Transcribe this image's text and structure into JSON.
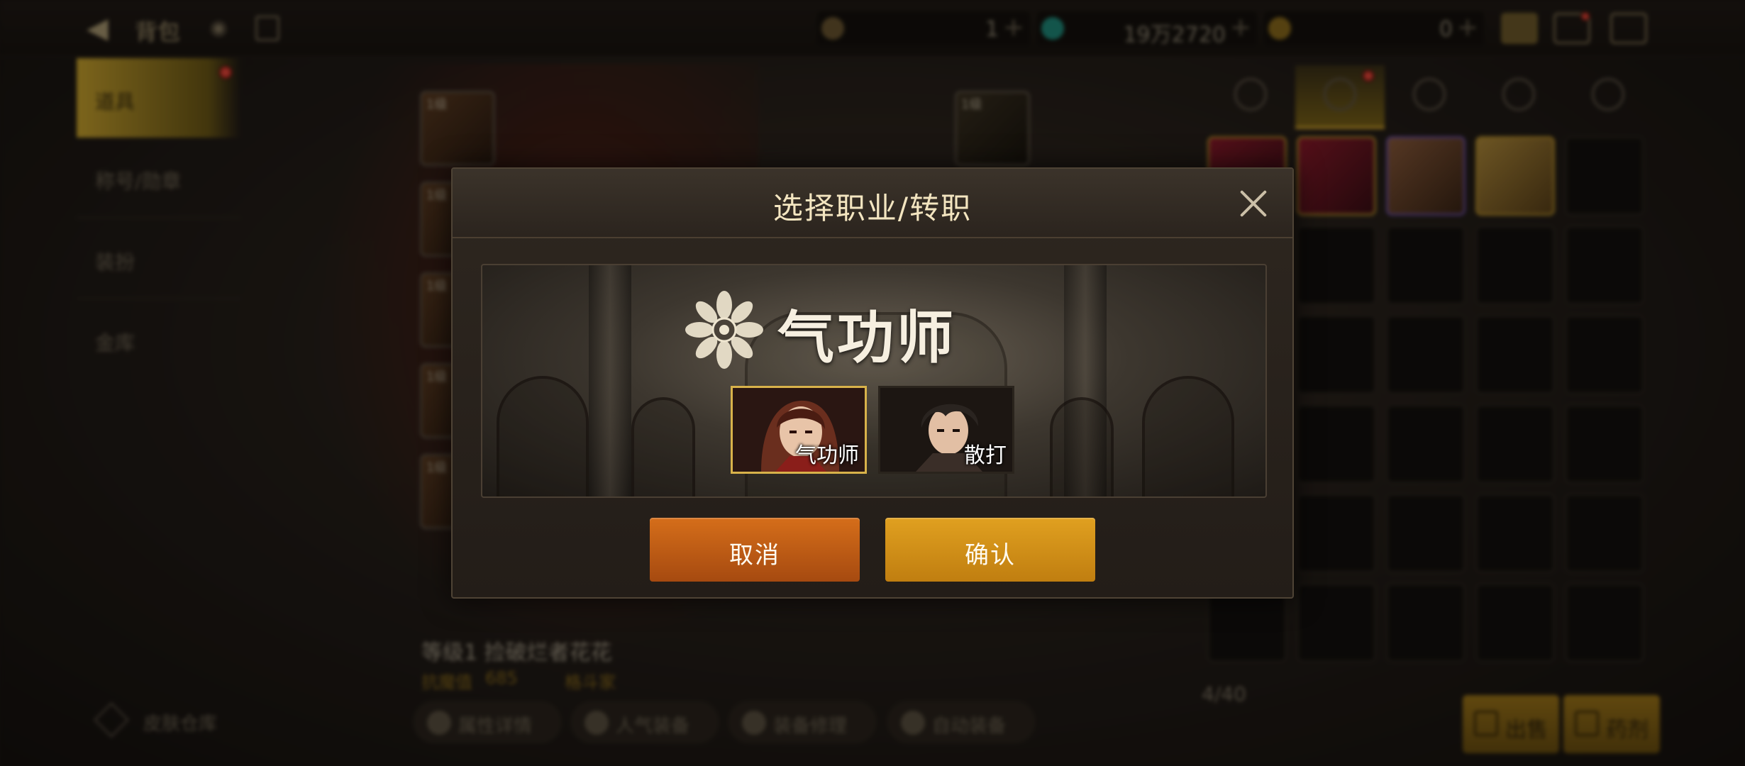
{
  "topbar": {
    "title": "背包",
    "currency": [
      {
        "icon": "moon-token-icon",
        "value": "1"
      },
      {
        "icon": "green-crystal-icon",
        "value": "19万2720"
      },
      {
        "icon": "gold-coin-icon",
        "value": "0"
      }
    ],
    "plus_glyph": "+"
  },
  "sidebar": {
    "items": [
      {
        "label": "道具"
      },
      {
        "label": "称号/勋章"
      },
      {
        "label": "装扮"
      },
      {
        "label": "金库"
      }
    ]
  },
  "equipment": {
    "slot_level": "1级"
  },
  "character": {
    "name": "等级1 捡破烂者花花",
    "score_label": "抗魔值",
    "score": "685",
    "class": "格斗家"
  },
  "bottom_actions": [
    {
      "label": "属性详情"
    },
    {
      "label": "人气装备"
    },
    {
      "label": "装备修理"
    },
    {
      "label": "自动装备"
    }
  ],
  "wardrobe": {
    "label": "皮肤仓库"
  },
  "bag": {
    "count": "4/40",
    "sell_label": "出售",
    "potion_label": "药剂"
  },
  "modal": {
    "title": "选择职业/转职",
    "selected_class": "气功师",
    "options": [
      {
        "label": "气功师",
        "selected": true
      },
      {
        "label": "散打",
        "selected": false
      }
    ],
    "cancel_label": "取消",
    "confirm_label": "确认"
  },
  "colors": {
    "accent_gold": "#c99c2b",
    "cancel_orange": "#c05e14",
    "confirm_gold": "#d09016",
    "selected_border": "#d8b24a"
  }
}
